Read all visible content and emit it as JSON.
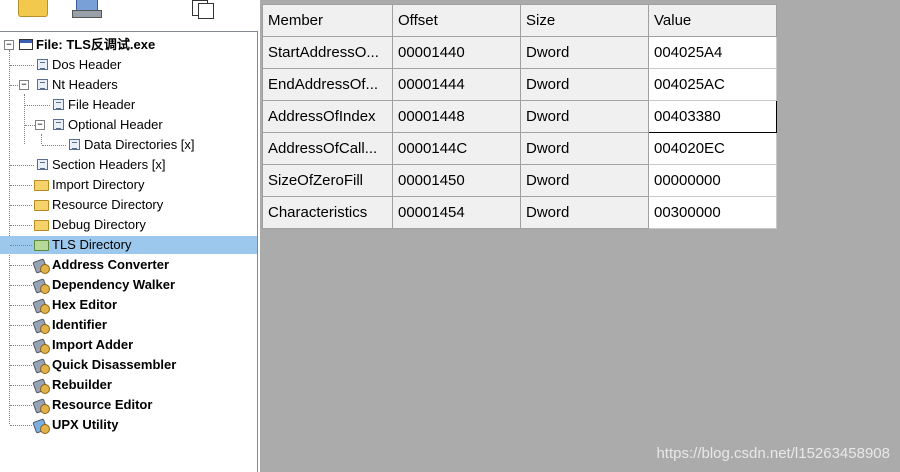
{
  "tree": {
    "root_label": "File: TLS反调试.exe",
    "items": [
      {
        "label": "Dos Header"
      },
      {
        "label": "Nt Headers"
      },
      {
        "label": "File Header"
      },
      {
        "label": "Optional Header"
      },
      {
        "label": "Data Directories [x]"
      },
      {
        "label": "Section Headers [x]"
      },
      {
        "label": "Import Directory"
      },
      {
        "label": "Resource Directory"
      },
      {
        "label": "Debug Directory"
      },
      {
        "label": "TLS Directory"
      },
      {
        "label": "Address Converter"
      },
      {
        "label": "Dependency Walker"
      },
      {
        "label": "Hex Editor"
      },
      {
        "label": "Identifier"
      },
      {
        "label": "Import Adder"
      },
      {
        "label": "Quick Disassembler"
      },
      {
        "label": "Rebuilder"
      },
      {
        "label": "Resource Editor"
      },
      {
        "label": "UPX Utility"
      }
    ]
  },
  "table": {
    "headers": [
      "Member",
      "Offset",
      "Size",
      "Value"
    ],
    "rows": [
      [
        "StartAddressO...",
        "00001440",
        "Dword",
        "004025A4"
      ],
      [
        "EndAddressOf...",
        "00001444",
        "Dword",
        "004025AC"
      ],
      [
        "AddressOfIndex",
        "00001448",
        "Dword",
        "00403380"
      ],
      [
        "AddressOfCall...",
        "0000144C",
        "Dword",
        "004020EC"
      ],
      [
        "SizeOfZeroFill",
        "00001450",
        "Dword",
        "00000000"
      ],
      [
        "Characteristics",
        "00001454",
        "Dword",
        "00300000"
      ]
    ]
  },
  "watermark": "https://blog.csdn.net/l15263458908",
  "colors": {
    "selection": "#9cc8ee",
    "pane_background": "#ababab"
  }
}
